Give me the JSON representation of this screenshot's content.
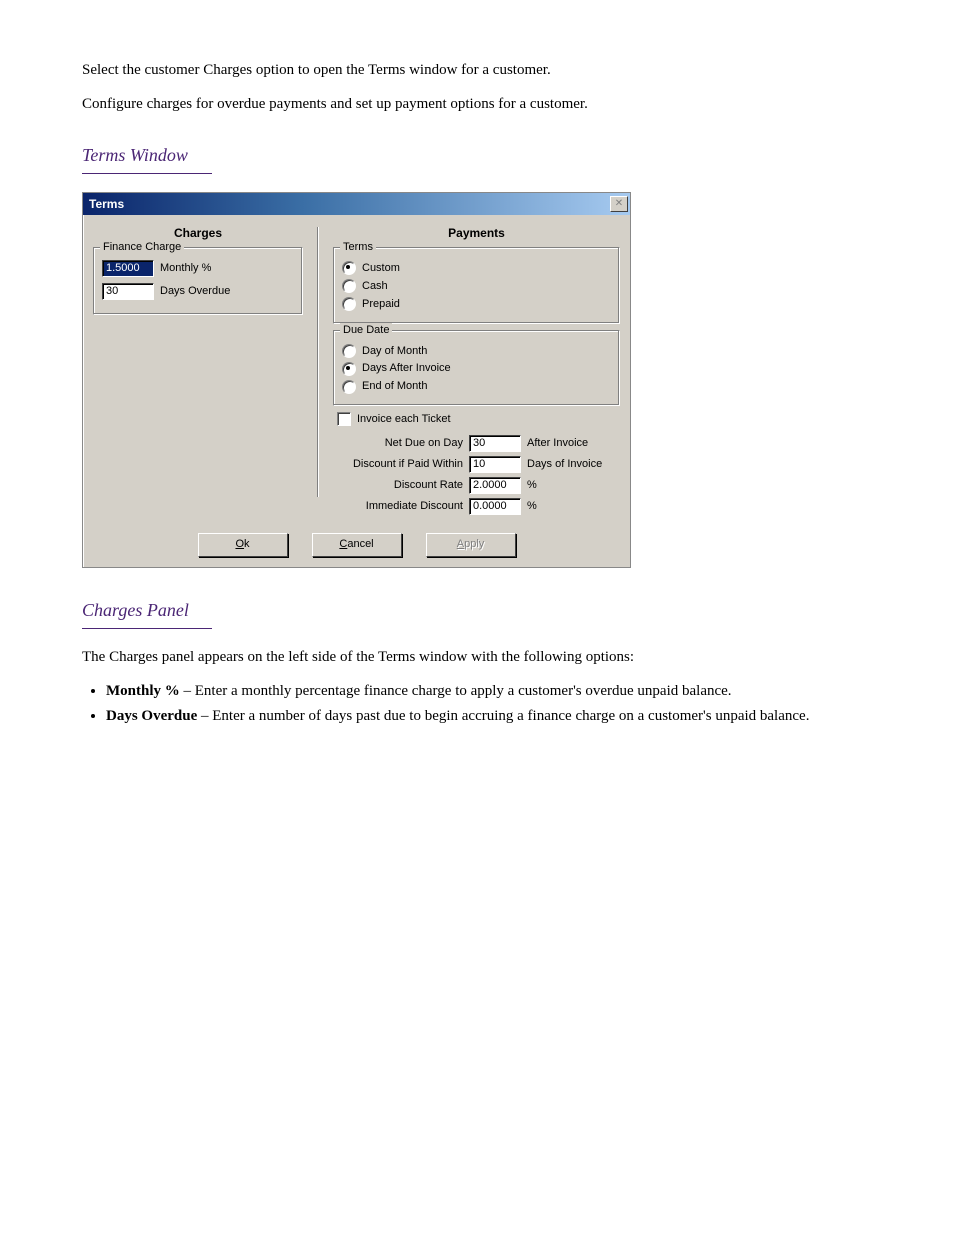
{
  "doc": {
    "para1": "Select the customer Charges option to open the Terms window for a customer.",
    "para2": "Configure charges for overdue payments and set up payment options for a customer.",
    "heading_terms": "Terms Window",
    "heading_charges": "Charges Panel",
    "charges_intro": "The Charges panel appears on the left side of the Terms window with the following options:",
    "bullets": {
      "b1_label": "Monthly %",
      "b1_text": " – Enter a monthly percentage finance charge to apply a customer's overdue unpaid balance.",
      "b2_label": "Days Overdue",
      "b2_text": " – Enter a number of days past due to begin accruing a finance charge on a customer's unpaid balance."
    }
  },
  "dialog": {
    "title": "Terms",
    "close_glyph": "✕",
    "headers": {
      "charges": "Charges",
      "payments": "Payments"
    },
    "finance_charge": {
      "legend": "Finance Charge",
      "monthly_value": "1.5000",
      "monthly_label": "Monthly %",
      "days_value": "30",
      "days_label": "Days Overdue"
    },
    "terms_group": {
      "legend": "Terms",
      "custom": "Custom",
      "cash": "Cash",
      "prepaid": "Prepaid",
      "selected": "custom"
    },
    "due_date_group": {
      "legend": "Due Date",
      "day_of_month": "Day of Month",
      "days_after_invoice": "Days After Invoice",
      "end_of_month": "End of Month",
      "selected": "days_after_invoice"
    },
    "invoice_each_label": "Invoice each Ticket",
    "rows": {
      "net_due_label": "Net Due on Day",
      "net_due_value": "30",
      "net_due_suffix": "After Invoice",
      "disc_within_label": "Discount if Paid Within",
      "disc_within_value": "10",
      "disc_within_suffix": "Days of Invoice",
      "disc_rate_label": "Discount Rate",
      "disc_rate_value": "2.0000",
      "percent": "%",
      "imm_disc_label": "Immediate Discount",
      "imm_disc_value": "0.0000"
    },
    "buttons": {
      "ok_u": "O",
      "ok_rest": "k",
      "cancel_u": "C",
      "cancel_rest": "ancel",
      "apply_u": "A",
      "apply_rest": "pply"
    }
  }
}
